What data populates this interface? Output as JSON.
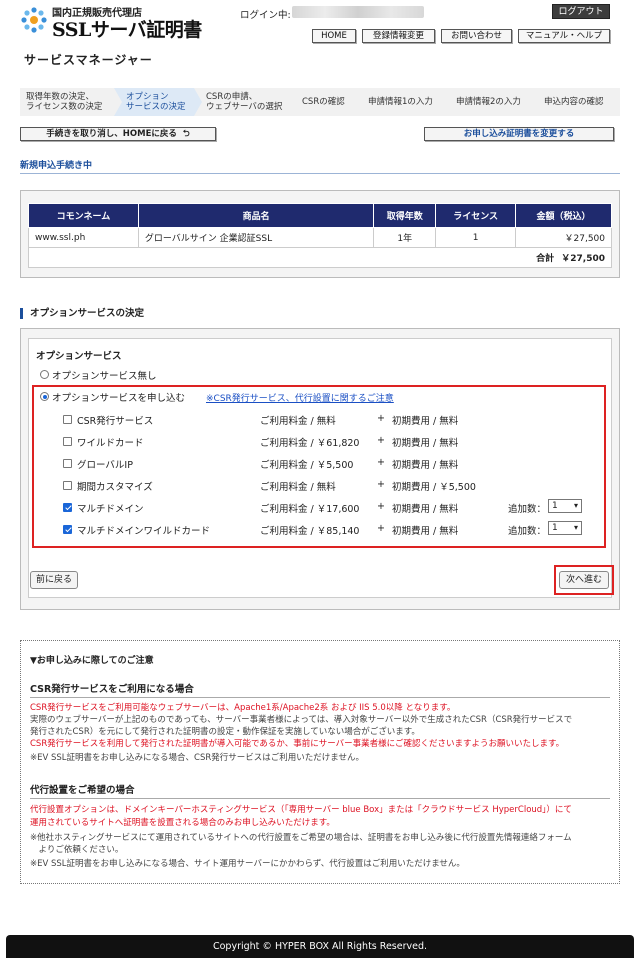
{
  "header": {
    "logo_sub": "国内正規販売代理店",
    "logo_main": "SSLサーバ証明書",
    "login_label": "ログイン中:",
    "logout": "ログアウト",
    "nav": [
      "HOME",
      "登録情報変更",
      "お問い合わせ",
      "マニュアル・ヘルプ"
    ],
    "subtitle": "サービスマネージャー"
  },
  "steps": [
    {
      "line1": "取得年数の決定、",
      "line2": "ライセンス数の決定"
    },
    {
      "line1": "オプション",
      "line2": "サービスの決定"
    },
    {
      "line1": "CSRの申請、",
      "line2": "ウェブサーバの選択"
    },
    {
      "line1": "CSRの確認",
      "line2": ""
    },
    {
      "line1": "申請情報1の入力",
      "line2": ""
    },
    {
      "line1": "申請情報2の入力",
      "line2": ""
    },
    {
      "line1": "申込内容の確認",
      "line2": ""
    }
  ],
  "actions": {
    "cancel_home": "手続きを取り消し、HOMEに戻る",
    "change_cert": "お申し込み証明書を変更する"
  },
  "status": "新規申込手続き中",
  "order_table": {
    "headers": [
      "コモンネーム",
      "商品名",
      "取得年数",
      "ライセンス",
      "金額（税込）"
    ],
    "row": [
      "www.ssl.ph",
      "グローバルサイン 企業認証SSL",
      "1年",
      "1",
      "￥27,500"
    ],
    "total_label": "合計",
    "total_value": "￥27,500"
  },
  "options": {
    "section_title": "オプションサービスの決定",
    "heading": "オプションサービス",
    "radio_none": "オプションサービス無し",
    "radio_apply": "オプションサービスを申し込む",
    "link": "※CSR発行サービス、代行設置に関するご注意",
    "plus": "+",
    "items": [
      {
        "name": "CSR発行サービス",
        "fee": "ご利用料金 / 無料",
        "init": "初期費用 / 無料",
        "checked": false,
        "qty_label": "",
        "qty": ""
      },
      {
        "name": "ワイルドカード",
        "fee": "ご利用料金 / ￥61,820",
        "init": "初期費用 / 無料",
        "checked": false,
        "qty_label": "",
        "qty": ""
      },
      {
        "name": "グローバルIP",
        "fee": "ご利用料金 / ￥5,500",
        "init": "初期費用 / 無料",
        "checked": false,
        "qty_label": "",
        "qty": ""
      },
      {
        "name": "期間カスタマイズ",
        "fee": "ご利用料金 / 無料",
        "init": "初期費用 / ￥5,500",
        "checked": false,
        "qty_label": "",
        "qty": ""
      },
      {
        "name": "マルチドメイン",
        "fee": "ご利用料金 / ￥17,600",
        "init": "初期費用 / 無料",
        "checked": true,
        "qty_label": "追加数：",
        "qty": "1"
      },
      {
        "name": "マルチドメインワイルドカード",
        "fee": "ご利用料金 / ￥85,140",
        "init": "初期費用 / 無料",
        "checked": true,
        "qty_label": "追加数：",
        "qty": "1"
      }
    ],
    "back": "前に戻る",
    "next": "次へ進む"
  },
  "notes": {
    "title": "▼お申し込みに際してのご注意",
    "csr_heading": "CSR発行サービスをご利用になる場合",
    "csr_lines": [
      {
        "text": "CSR発行サービスをご利用可能なウェブサーバーは、Apache1系/Apache2系 および IIS 5.0以降 となります。",
        "color": "red"
      },
      {
        "text": "実際のウェブサーバーが上記のものであっても、サーバー事業者様によっては、導入対象サーバー以外で生成されたCSR（CSR発行サービスで",
        "color": "gray"
      },
      {
        "text": "発行されたCSR）を元にして発行された証明書の設定・動作保証を実施していない場合がございます。",
        "color": "gray"
      },
      {
        "text": "CSR発行サービスを利用して発行された証明書が導入可能であるか、事前にサーバー事業者様にご確認くださいますようお願いいたします。",
        "color": "red"
      },
      {
        "text": "※EV SSL証明書をお申し込みになる場合、CSR発行サービスはご利用いただけません。",
        "color": "gray"
      }
    ],
    "install_heading": "代行設置をご希望の場合",
    "install_lines": [
      {
        "text": "代行設置オプションは、ドメインキーパーホスティングサービス（「専用サーバー blue Box」または「クラウドサービス HyperCloud」）にて",
        "color": "red"
      },
      {
        "text": "運用されているサイトへ証明書を設置される場合のみお申し込みいただけます。",
        "color": "red"
      },
      {
        "text": "※他社ホスティングサービスにて運用されているサイトへの代行設置をご希望の場合は、証明書をお申し込み後に代行設置先情報連絡フォーム",
        "color": "gray"
      },
      {
        "text": "　よりご依頼ください。",
        "color": "gray"
      },
      {
        "text": "※EV SSL証明書をお申し込みになる場合、サイト運用サーバーにかかわらず、代行設置はご利用いただけません。",
        "color": "gray"
      }
    ]
  },
  "footer": "Copyright © HYPER BOX All Rights Reserved."
}
